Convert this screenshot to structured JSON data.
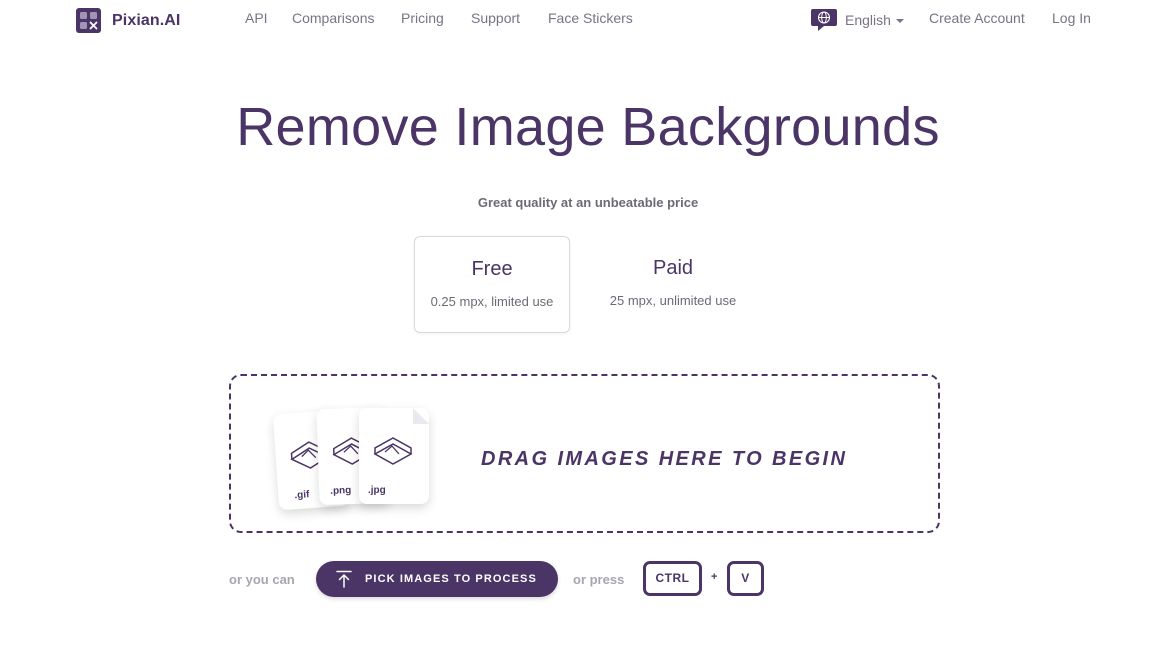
{
  "brand": {
    "name": "Pixian.AI",
    "logo_icon": "pixian-logo-icon"
  },
  "nav": {
    "links": [
      {
        "label": "API"
      },
      {
        "label": "Comparisons"
      },
      {
        "label": "Pricing"
      },
      {
        "label": "Support"
      },
      {
        "label": "Face Stickers"
      }
    ],
    "language": {
      "label": "English",
      "icon": "globe-chat-icon"
    },
    "create_account": "Create Account",
    "login": "Log In"
  },
  "hero": {
    "title": "Remove Image Backgrounds",
    "subtitle": "Great quality at an unbeatable price"
  },
  "plans": [
    {
      "name": "Free",
      "desc": "0.25 mpx, limited use",
      "selected": true
    },
    {
      "name": "Paid",
      "desc": "25 mpx, unlimited use",
      "selected": false
    }
  ],
  "dropzone": {
    "text": "DRAG IMAGES HERE TO BEGIN",
    "file_types": [
      ".gif",
      ".png",
      ".jpg"
    ]
  },
  "actions": {
    "or_you_can": "or you can",
    "pick_button": "PICK IMAGES TO PROCESS",
    "pick_icon": "upload-arrow-icon",
    "or_press": "or press",
    "key_ctrl": "CTRL",
    "plus": "+",
    "key_v": "V"
  },
  "colors": {
    "brand_purple": "#4b3466",
    "nav_text": "#7a7385",
    "muted_text": "#a9a5ae"
  }
}
